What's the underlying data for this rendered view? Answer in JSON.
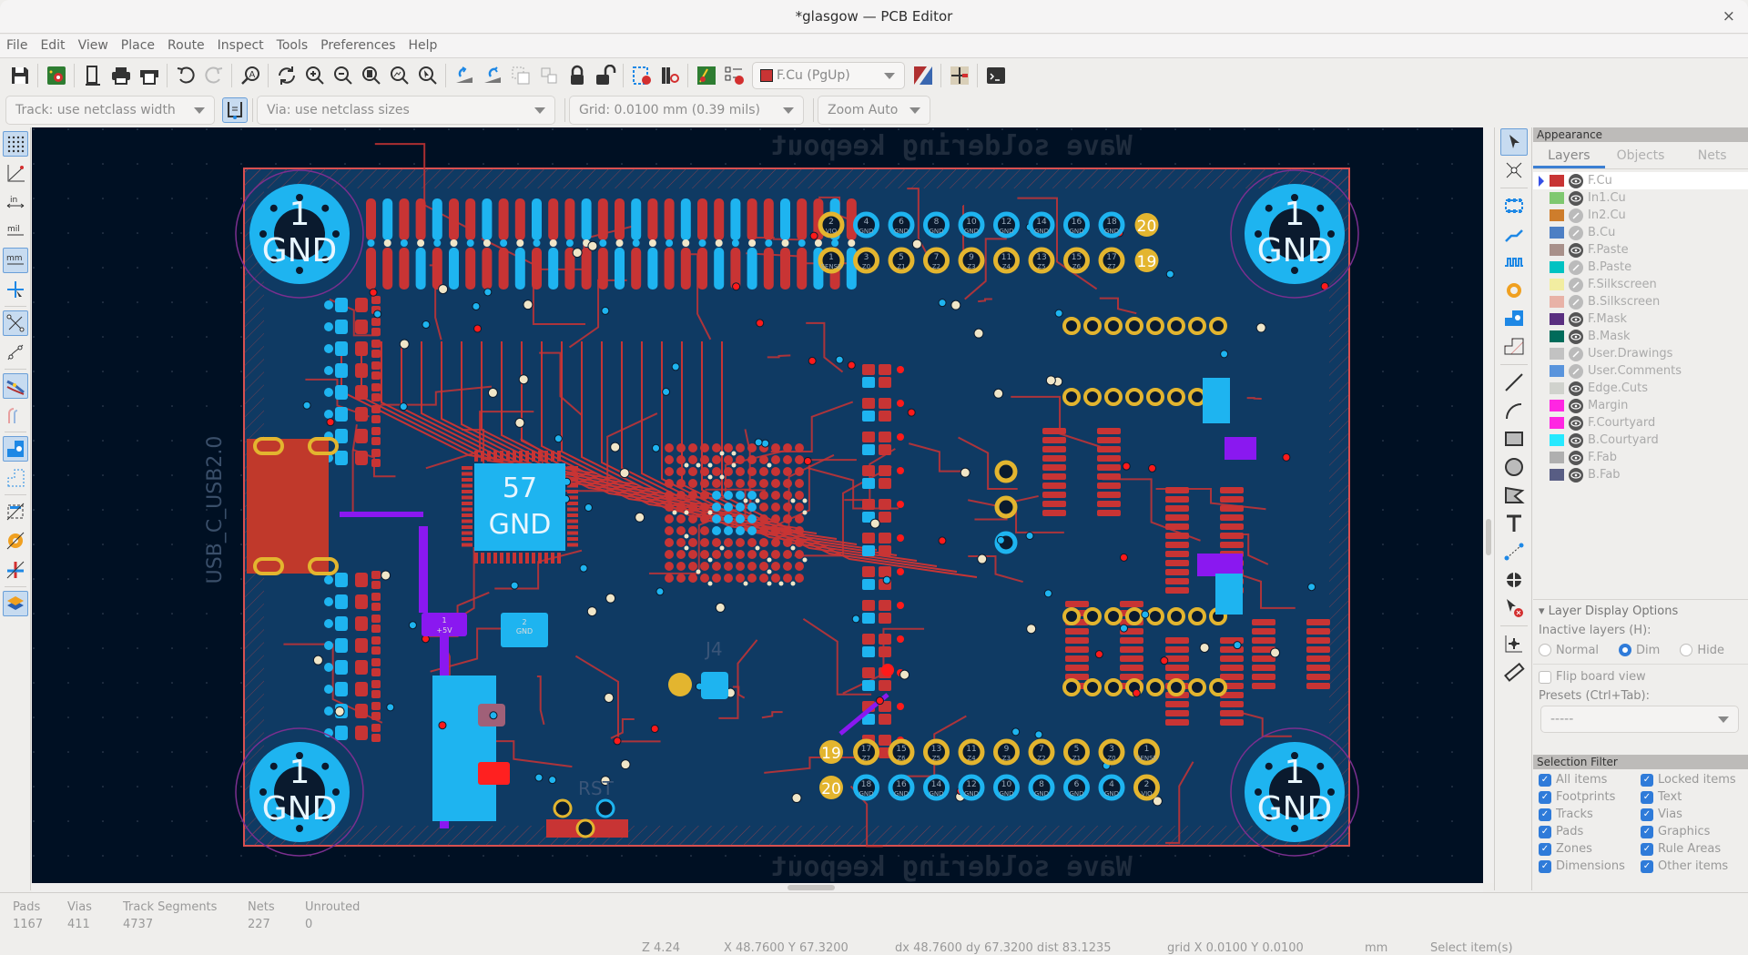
{
  "window": {
    "title": "*glasgow — PCB Editor",
    "close_glyph": "×"
  },
  "menu": [
    "File",
    "Edit",
    "View",
    "Place",
    "Route",
    "Inspect",
    "Tools",
    "Preferences",
    "Help"
  ],
  "toolbar": {
    "layer_selector": {
      "value": "F.Cu (PgUp)",
      "swatch": "#c83434"
    },
    "icons": [
      "save-icon",
      "board-setup-icon",
      "page-settings-icon",
      "print-icon",
      "plot-icon",
      "undo-icon",
      "redo-icon",
      "find-icon",
      "refresh-icon",
      "zoom-in-icon",
      "zoom-out-icon",
      "zoom-fit-icon",
      "zoom-objects-icon",
      "zoom-selection-icon",
      "rotate-ccw-icon",
      "rotate-cw-icon",
      "group-icon",
      "ungroup-icon",
      "lock-icon",
      "unlock-icon",
      "footprint-editor-icon",
      "footprint-browser-icon",
      "update-pcb-icon",
      "drc-icon",
      "layer-pair-icon",
      "net-inspector-icon",
      "scripting-console-icon"
    ]
  },
  "options": {
    "track": "Track: use netclass width",
    "via": "Via: use netclass sizes",
    "grid": "Grid: 0.0100 mm (0.39 mils)",
    "zoom": "Zoom Auto"
  },
  "left_toolbar": [
    "grid-toggle-icon",
    "polar-coords-icon",
    "units-inch-icon",
    "units-mil-icon",
    "units-mm-icon",
    "full-crosshair-icon",
    "ratsnest-icon",
    "curved-ratsnest-icon",
    "high-contrast-track-icon",
    "track-outline-icon",
    "pad-fill-icon",
    "graphic-outline-icon",
    "footprint-text-icon",
    "via-outline-icon",
    "track-clearance-icon",
    "layer-manager-icon"
  ],
  "right_toolbar": [
    "select-icon",
    "local-ratsnest-icon",
    "add-footprint-icon",
    "route-track-icon",
    "tune-length-icon",
    "add-via-icon",
    "add-zone-icon",
    "rule-area-icon",
    "draw-line-icon",
    "draw-arc-icon",
    "draw-rectangle-icon",
    "draw-circle-icon",
    "draw-polygon-icon",
    "add-text-icon",
    "add-dimension-icon",
    "add-anchor-icon",
    "delete-tool-icon",
    "grid-origin-icon",
    "measure-icon"
  ],
  "panel": {
    "appearance_title": "Appearance",
    "tabs": [
      "Layers",
      "Objects",
      "Nets"
    ],
    "active_tab": "Layers",
    "layers": [
      {
        "name": "F.Cu",
        "color": "#c83434",
        "visible": true,
        "selected": true
      },
      {
        "name": "In1.Cu",
        "color": "#7fc870",
        "visible": true
      },
      {
        "name": "In2.Cu",
        "color": "#ce7d2c",
        "visible": false
      },
      {
        "name": "B.Cu",
        "color": "#4d7fc4",
        "visible": false
      },
      {
        "name": "F.Paste",
        "color": "#a8908a",
        "visible": true
      },
      {
        "name": "B.Paste",
        "color": "#00c2c2",
        "visible": false
      },
      {
        "name": "F.Silkscreen",
        "color": "#f2eda1",
        "visible": false
      },
      {
        "name": "B.Silkscreen",
        "color": "#e8b2a7",
        "visible": false
      },
      {
        "name": "F.Mask",
        "color": "#5a2f80",
        "visible": true
      },
      {
        "name": "B.Mask",
        "color": "#006b5a",
        "visible": true
      },
      {
        "name": "User.Drawings",
        "color": "#c2c2c2",
        "visible": false
      },
      {
        "name": "User.Comments",
        "color": "#5994dc",
        "visible": false
      },
      {
        "name": "Edge.Cuts",
        "color": "#d0d2cd",
        "visible": true
      },
      {
        "name": "Margin",
        "color": "#ff26e2",
        "visible": true
      },
      {
        "name": "F.Courtyard",
        "color": "#ff26e2",
        "visible": true
      },
      {
        "name": "B.Courtyard",
        "color": "#26e9ff",
        "visible": true
      },
      {
        "name": "F.Fab",
        "color": "#afafaf",
        "visible": true
      },
      {
        "name": "B.Fab",
        "color": "#585d84",
        "visible": true
      }
    ],
    "layer_display_options": "Layer Display Options",
    "inactive_label": "Inactive layers (H):",
    "inactive_options": [
      "Normal",
      "Dim",
      "Hide"
    ],
    "inactive_selected": "Dim",
    "flip_board": "Flip board view",
    "flip_checked": false,
    "presets_label": "Presets (Ctrl+Tab):",
    "presets_value": "-----",
    "selection_filter_title": "Selection Filter",
    "selection_filter": [
      {
        "label": "All items",
        "checked": true
      },
      {
        "label": "Locked items",
        "checked": true
      },
      {
        "label": "Footprints",
        "checked": true
      },
      {
        "label": "Text",
        "checked": true
      },
      {
        "label": "Tracks",
        "checked": true
      },
      {
        "label": "Vias",
        "checked": true
      },
      {
        "label": "Pads",
        "checked": true
      },
      {
        "label": "Graphics",
        "checked": true
      },
      {
        "label": "Zones",
        "checked": true
      },
      {
        "label": "Rule Areas",
        "checked": true
      },
      {
        "label": "Dimensions",
        "checked": true
      },
      {
        "label": "Other items",
        "checked": true
      }
    ]
  },
  "board": {
    "keepout_text": "Wave soldering keepout",
    "mounting_hole_number": "1",
    "mounting_hole_net": "GND",
    "usb_label": "USB_C_USB2.0",
    "ic_pad_number": "57",
    "ic_pad_net": "GND",
    "header_top_pins_even": [
      "2",
      "4",
      "6",
      "8",
      "10",
      "12",
      "14",
      "16",
      "18",
      "20"
    ],
    "header_top_pins_odd": [
      "1",
      "3",
      "5",
      "7",
      "9",
      "11",
      "13",
      "15",
      "17",
      "19"
    ],
    "header_net_even": [
      "VIO",
      "GND",
      "GND",
      "GND",
      "GND",
      "GND",
      "GND",
      "GND",
      "GND",
      ""
    ],
    "header_net_odd": [
      "SENSE",
      "Z0",
      "Z1",
      "Z2",
      "Z3",
      "Z4",
      "Z5",
      "Z6",
      "Z7",
      ""
    ],
    "ref_j4": "J4",
    "ref_rst": "RST",
    "cap_pad1": "1",
    "cap_net1": "+5V",
    "cap_pad2": "2",
    "cap_net2": "GND",
    "colors": {
      "background": "#001023",
      "board": "#0f3a63",
      "fcu": "#c83434",
      "bcu": "#1eb4f0",
      "pth": "#e3b52f",
      "edge": "#d85050",
      "courtyard": "#7b2f8f",
      "via_hl": "#ff1a1a",
      "net_hl": "#8a18f0"
    }
  },
  "status": {
    "pads_label": "Pads",
    "pads": "1167",
    "vias_label": "Vias",
    "vias": "411",
    "tracks_label": "Track Segments",
    "tracks": "4737",
    "nets_label": "Nets",
    "nets": "227",
    "unrouted_label": "Unrouted",
    "unrouted": "0",
    "zoom": "Z 4.24",
    "xy": "X 48.7600  Y 67.3200",
    "delta": "dx 48.7600  dy 67.3200  dist 83.1235",
    "grid": "grid X 0.0100  Y 0.0100",
    "units": "mm",
    "mode": "Select item(s)"
  }
}
